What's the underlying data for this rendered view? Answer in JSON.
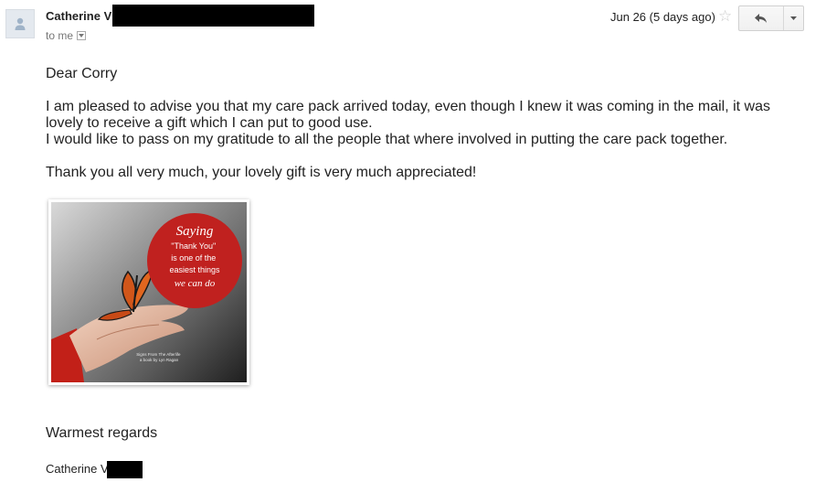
{
  "header": {
    "sender_name": "Catherine V",
    "recipient_label": "to me",
    "date": "Jun 26 (5 days ago)"
  },
  "icons": {
    "avatar": "person-icon",
    "star": "star-outline-icon",
    "reply": "reply-arrow-icon",
    "more": "dropdown-caret-icon"
  },
  "body": {
    "greeting": "Dear Corry",
    "paragraph_line1": "I am pleased to advise you that my care pack arrived today, even though I knew it was coming in the mail, it was lovely to receive a gift which I can put to good use.",
    "paragraph_line2": "I would like to pass on my gratitude to all the people that where involved in putting the care pack together.",
    "thanks": "Thank you all very much, your lovely gift is very much appreciated!",
    "image": {
      "quote_line1": "Saying",
      "quote_line2": "\"Thank You\"",
      "quote_line3": "is one of the",
      "quote_line4": "easiest things",
      "quote_line5": "we can do",
      "credit_line1": "Signs From The Afterlife",
      "credit_line2": "a book by Lyn Ragan"
    },
    "closing": "Warmest regards",
    "signature": "Catherine V"
  },
  "colors": {
    "quote_circle": "#c0211f",
    "redaction": "#000000"
  }
}
